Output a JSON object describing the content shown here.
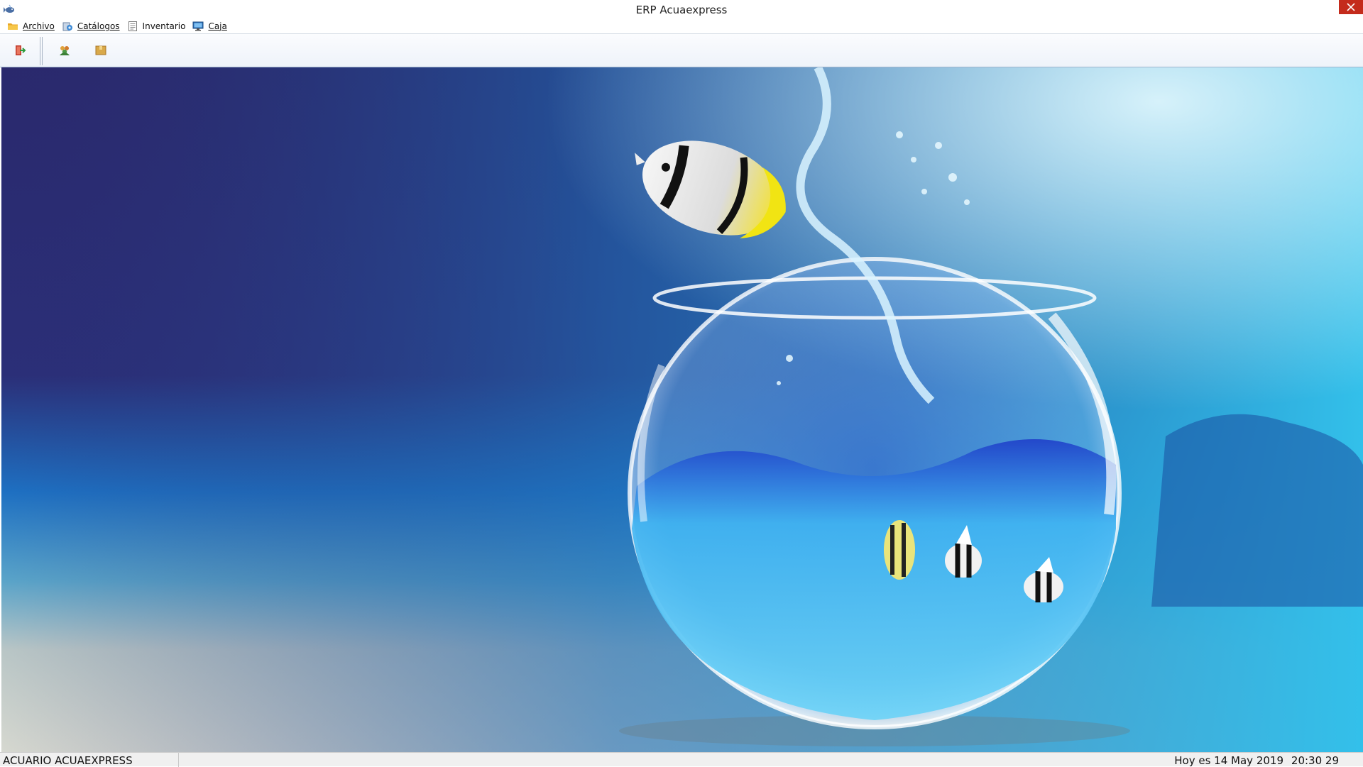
{
  "window": {
    "title": "ERP Acuaexpress",
    "app_icon": "fish-app-icon",
    "close_icon": "close-icon"
  },
  "menu": {
    "items": [
      {
        "label": "Archivo",
        "icon": "folder-icon"
      },
      {
        "label": "Catálogos",
        "icon": "catalog-icon"
      },
      {
        "label": "Inventario",
        "icon": "document-list-icon"
      },
      {
        "label": "Caja",
        "icon": "monitor-icon"
      }
    ]
  },
  "toolbar": {
    "buttons": [
      {
        "icon": "exit-door-icon"
      },
      {
        "icon": "users-group-icon"
      },
      {
        "icon": "package-box-icon"
      }
    ]
  },
  "background": {
    "image": "aquarium-fishbowl-wallpaper",
    "colors": {
      "deep": "#2a2b6e",
      "water": "#1ea8dc",
      "sand": "#c9cfc8"
    }
  },
  "statusbar": {
    "company": "ACUARIO ACUAEXPRESS",
    "date": "Hoy es 14 May 2019",
    "time": "20:30 29"
  }
}
